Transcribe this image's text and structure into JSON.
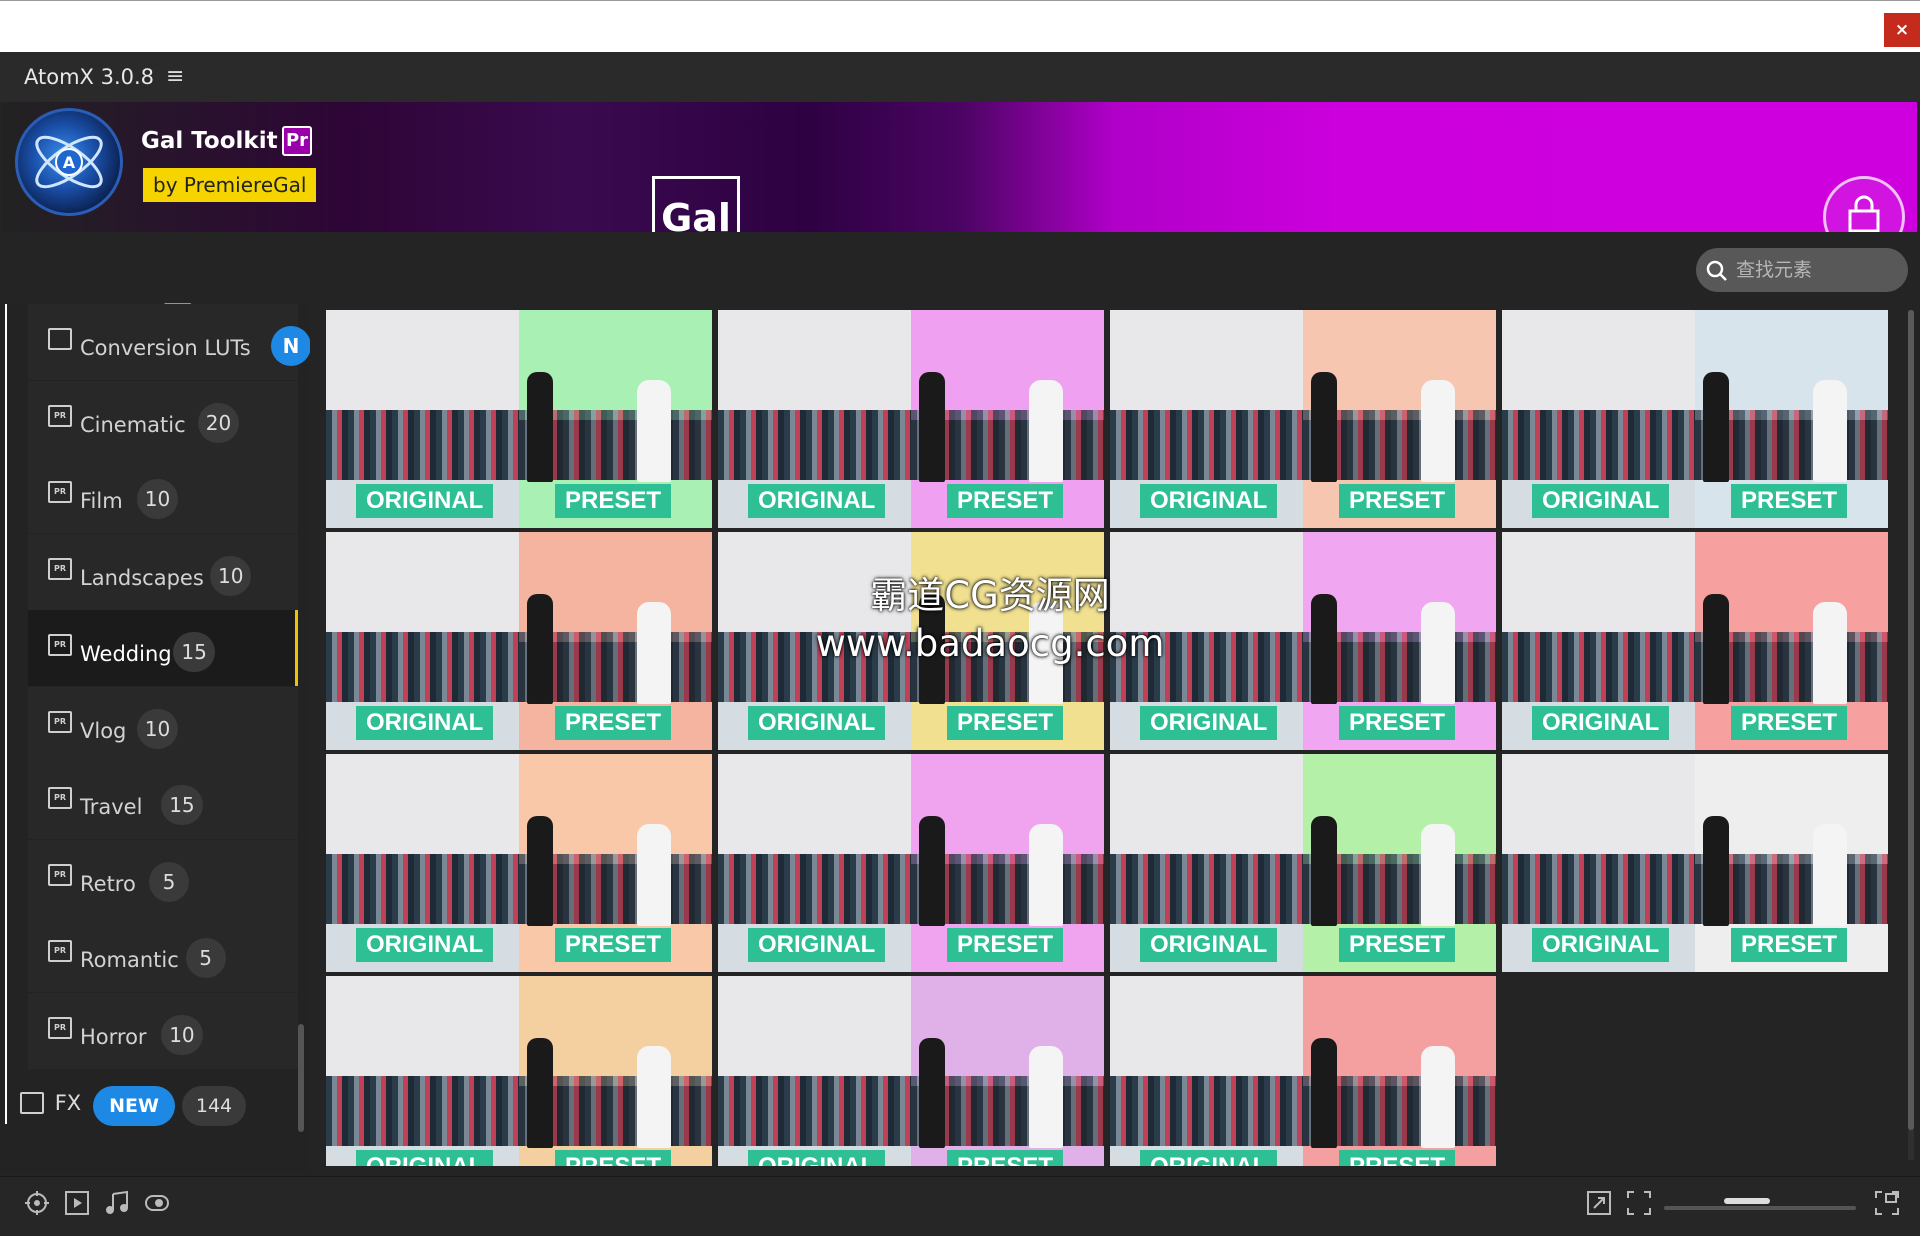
{
  "window": {
    "close_label": "×"
  },
  "app": {
    "title": "AtomX 3.0.8",
    "menu_icon": "hamburger-menu-icon"
  },
  "banner": {
    "brand": "Gal Toolkit",
    "pr_badge": "Pr",
    "by_label": "by PremiereGal",
    "center_logo": "Gal",
    "bag_icon": "shopping-bag-icon"
  },
  "toolbar": {
    "icons": [
      "sliders-icon",
      "list-view-icon",
      "media-file-icon",
      "star-icon"
    ],
    "search_placeholder": "查找元素"
  },
  "sidebar": {
    "categories": [
      {
        "label": "Conversion LUTs",
        "count": "N"
      },
      {
        "label": "Cinematic",
        "count": "20"
      },
      {
        "label": "Film",
        "count": "10"
      },
      {
        "label": "Landscapes",
        "count": "10"
      },
      {
        "label": "Wedding",
        "count": "15",
        "selected": true
      },
      {
        "label": "Vlog",
        "count": "10"
      },
      {
        "label": "Travel",
        "count": "15"
      },
      {
        "label": "Retro",
        "count": "5"
      },
      {
        "label": "Romantic",
        "count": "5"
      },
      {
        "label": "Horror",
        "count": "10"
      }
    ],
    "fx": {
      "label": "FX",
      "badge": "NEW",
      "count": "144"
    }
  },
  "grid": {
    "original_label": "ORIGINAL",
    "preset_label": "PRESET",
    "tiles": [
      {
        "tint": "#a8f0b4"
      },
      {
        "tint": "#f0a0f0"
      },
      {
        "tint": "#f6c6b0"
      },
      {
        "tint": "#d8e4ec"
      },
      {
        "tint": "#f4b4a0"
      },
      {
        "tint": "#f0e090"
      },
      {
        "tint": "#f0a6f0"
      },
      {
        "tint": "#f6a0a0"
      },
      {
        "tint": "#f8c8a8"
      },
      {
        "tint": "#f0a4f0"
      },
      {
        "tint": "#b4f0a8"
      },
      {
        "tint": "#eeeeee"
      },
      {
        "tint": "#f4d0a0"
      },
      {
        "tint": "#e0b0e8"
      },
      {
        "tint": "#f4a0a0"
      }
    ]
  },
  "watermark": {
    "line1": "霸道CG资源网",
    "line2": "www.badaocg.com"
  },
  "bottom": {
    "left_icons": [
      "target-icon",
      "play-icon",
      "music-note-icon",
      "eye-icon"
    ],
    "right_icons": [
      "expand-icon",
      "fit-icon",
      "fullscreen-icon"
    ]
  }
}
